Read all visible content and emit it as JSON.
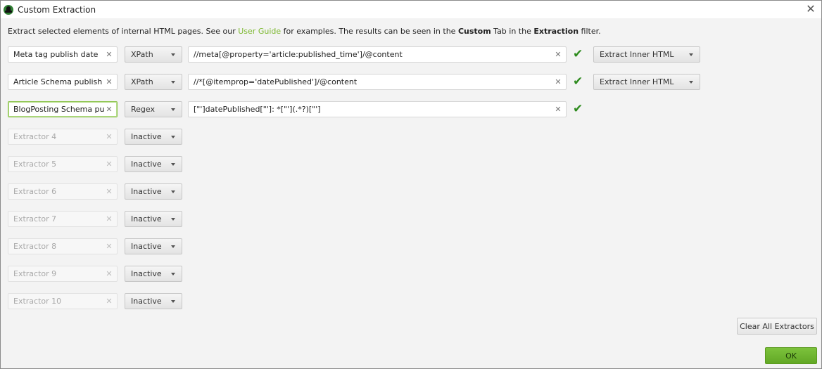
{
  "window": {
    "title": "Custom Extraction",
    "close_icon": "close-icon"
  },
  "intro": {
    "part1": "Extract selected elements of internal HTML pages. See our ",
    "link": "User Guide",
    "part2": " for examples. The results can be seen in the ",
    "bold1": "Custom",
    "part3": " Tab in the ",
    "bold2": "Extraction",
    "part4": " filter."
  },
  "colors": {
    "accent_green": "#7cb82f",
    "check_green": "#2e8b1e",
    "ok_button": "#6fb530"
  },
  "extractors": [
    {
      "name": "Meta tag publish date",
      "type": "XPath",
      "expression": "//meta[@property='article:published_time']/@content",
      "valid": true,
      "extract_mode": "Extract Inner HTML",
      "active": true,
      "focused": false
    },
    {
      "name": "Article Schema publish date",
      "type": "XPath",
      "expression": "//*[@itemprop='datePublished']/@content",
      "valid": true,
      "extract_mode": "Extract Inner HTML",
      "active": true,
      "focused": false
    },
    {
      "name": "BlogPosting Schema publish date",
      "type": "Regex",
      "expression": "[\"']datePublished[\"']: *[\"'](.*?)[\"']",
      "valid": true,
      "extract_mode": null,
      "active": true,
      "focused": true
    },
    {
      "name": "Extractor 4",
      "type": "Inactive",
      "active": false
    },
    {
      "name": "Extractor 5",
      "type": "Inactive",
      "active": false
    },
    {
      "name": "Extractor 6",
      "type": "Inactive",
      "active": false
    },
    {
      "name": "Extractor 7",
      "type": "Inactive",
      "active": false
    },
    {
      "name": "Extractor 8",
      "type": "Inactive",
      "active": false
    },
    {
      "name": "Extractor 9",
      "type": "Inactive",
      "active": false
    },
    {
      "name": "Extractor 10",
      "type": "Inactive",
      "active": false
    }
  ],
  "buttons": {
    "clear_all": "Clear All Extractors",
    "ok": "OK"
  }
}
